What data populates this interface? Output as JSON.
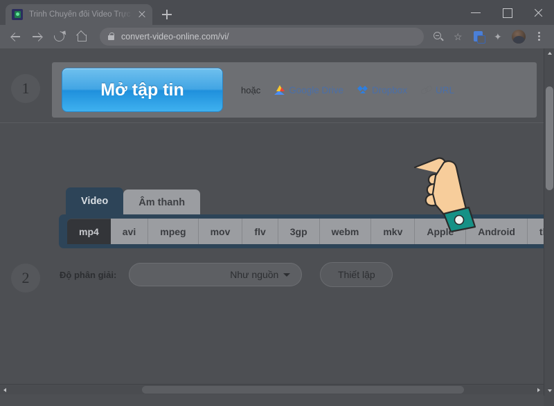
{
  "browser": {
    "tab": {
      "title": "Trinh Chuyển đổi Video Trực tuyế",
      "favicon_name": "video-converter-favicon",
      "close_label": "×",
      "newtab_label": "+"
    },
    "window_controls": {
      "minimize": "–",
      "maximize": "□",
      "close": "×"
    },
    "toolbar": {
      "back": "←",
      "forward": "→",
      "reload": "⟳",
      "home": "⌂",
      "url": "convert-video-online.com/vi/",
      "lock_icon": "lock-icon",
      "icons": [
        {
          "name": "zoom-icon",
          "label": ""
        },
        {
          "name": "bookmark-star-icon",
          "label": "☆"
        },
        {
          "name": "translate-icon",
          "label": ""
        },
        {
          "name": "extensions-puzzle-icon",
          "label": "✦"
        },
        {
          "name": "profile-avatar",
          "label": ""
        },
        {
          "name": "chrome-menu-icon",
          "label": ""
        }
      ]
    }
  },
  "page": {
    "step1": {
      "badge": "1",
      "open_file_button": "Mở tập tin",
      "or_text": "hoặc",
      "sources": [
        {
          "name": "google-drive",
          "label": "Google Drive"
        },
        {
          "name": "dropbox",
          "label": "Dropbox"
        },
        {
          "name": "url",
          "label": "URL"
        }
      ]
    },
    "step2": {
      "badge": "2",
      "tabs": [
        {
          "label": "Video",
          "active": true
        },
        {
          "label": "Âm thanh",
          "active": false
        }
      ],
      "formats": [
        {
          "label": "mp4",
          "active": true
        },
        {
          "label": "avi",
          "active": false
        },
        {
          "label": "mpeg",
          "active": false
        },
        {
          "label": "mov",
          "active": false
        },
        {
          "label": "flv",
          "active": false
        },
        {
          "label": "3gp",
          "active": false
        },
        {
          "label": "webm",
          "active": false
        },
        {
          "label": "mkv",
          "active": false
        },
        {
          "label": "Apple",
          "active": false
        },
        {
          "label": "Android",
          "active": false
        },
        {
          "label": "thêm",
          "active": false
        }
      ],
      "resolution_label": "Độ phân giải:",
      "resolution_value": "Như nguồn",
      "settings_button": "Thiết lập"
    },
    "pointer_hand": "pointing-hand-cursor"
  },
  "colors": {
    "accent_blue": "#42a5e4",
    "tab_active_navy": "#2d4458",
    "page_overlay": "#4d4f53",
    "link_blue": "#4a6fa8",
    "hand_skin": "#f4c28a",
    "hand_sleeve": "#1a9183"
  }
}
